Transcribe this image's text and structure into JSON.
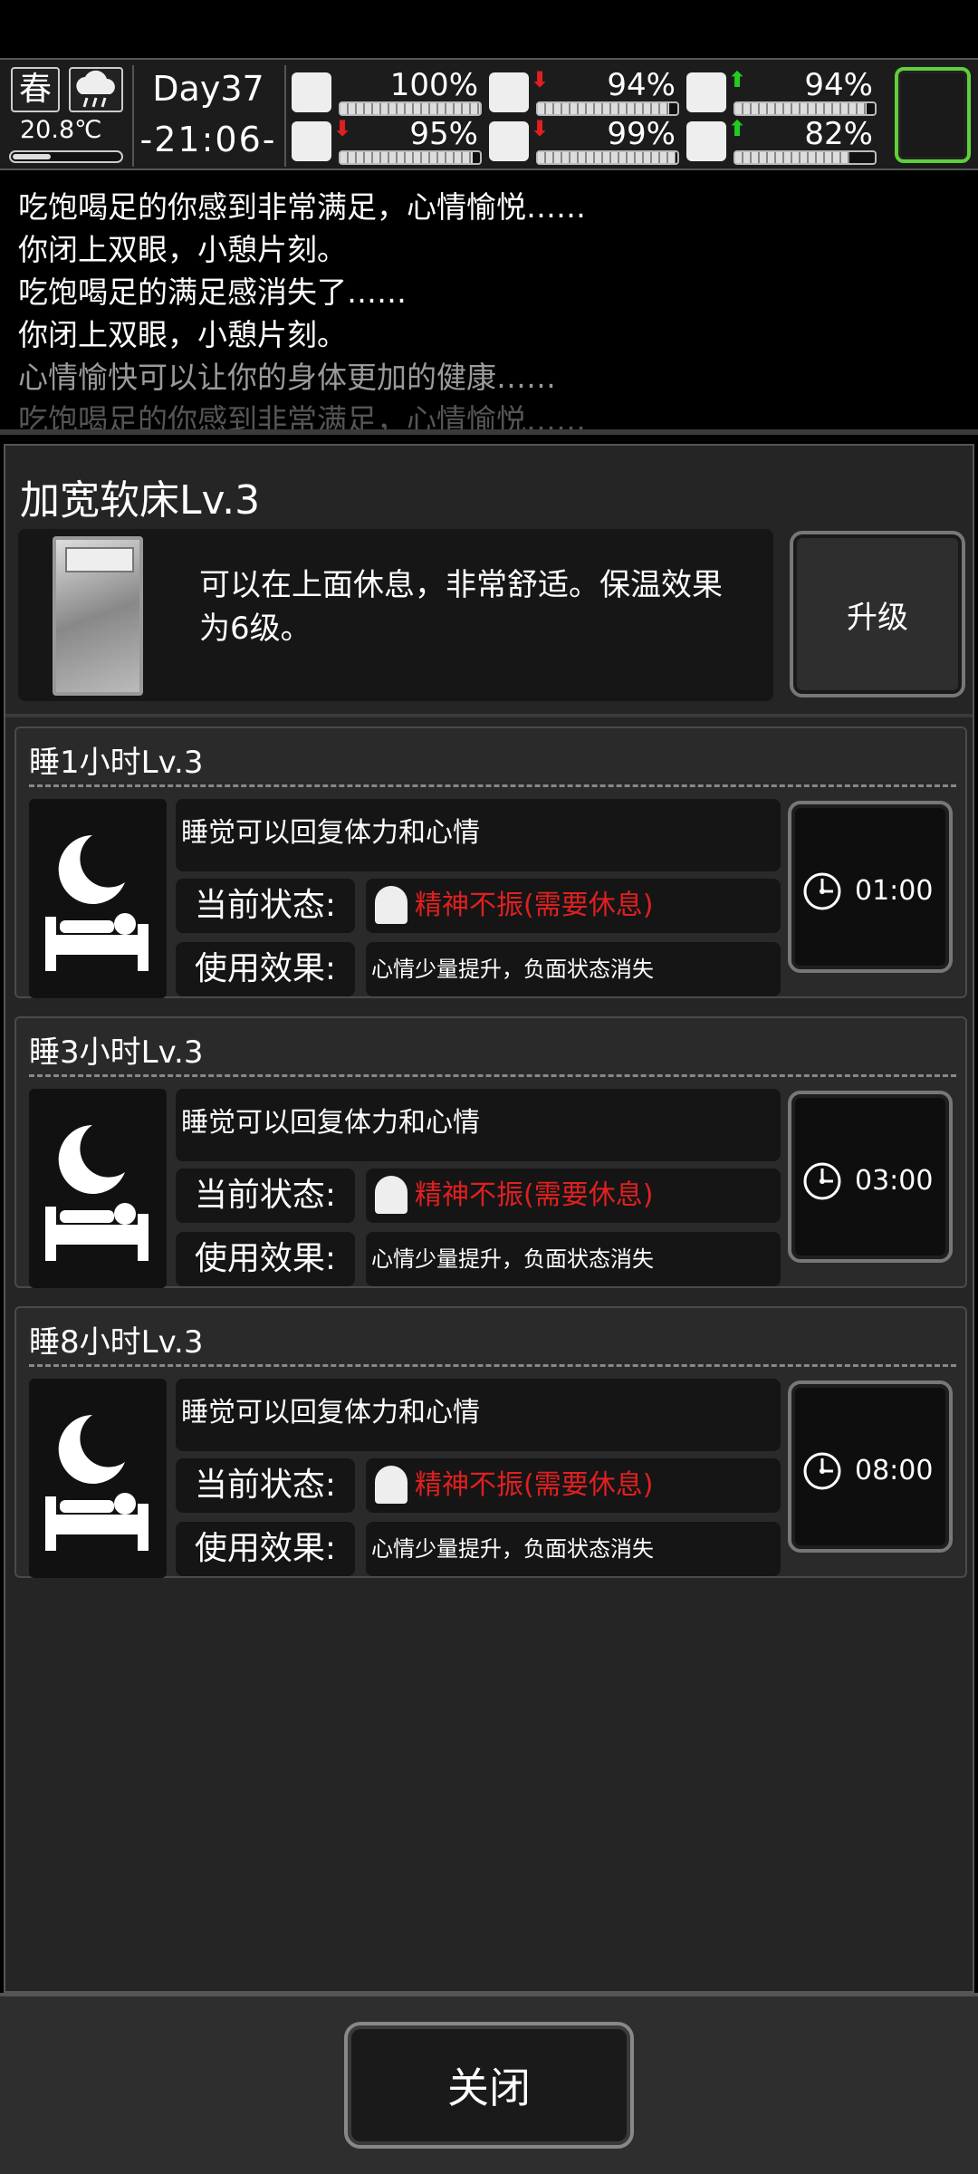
{
  "status": {
    "season": "春",
    "temperature": "20.8℃",
    "temperature_level": 0.35,
    "day": "Day37",
    "time": "-21:06-",
    "stats": [
      {
        "icon": "medkit-icon",
        "percent": "100%",
        "level": 1.0,
        "arrow": "",
        "arrow_color": ""
      },
      {
        "icon": "stomach-icon",
        "percent": "94%",
        "level": 0.94,
        "arrow": "⬇",
        "arrow_color": "#e02020"
      },
      {
        "icon": "head-icon",
        "percent": "94%",
        "level": 0.94,
        "arrow": "⬆",
        "arrow_color": "#22cc22"
      },
      {
        "icon": "boot-icon",
        "percent": "95%",
        "level": 0.95,
        "arrow": "⬇",
        "arrow_color": "#e02020"
      },
      {
        "icon": "water-drop-icon",
        "percent": "99%",
        "level": 0.99,
        "arrow": "⬇",
        "arrow_color": "#e02020"
      },
      {
        "icon": "heart-icon",
        "percent": "82%",
        "level": 0.82,
        "arrow": "⬆",
        "arrow_color": "#22cc22"
      }
    ]
  },
  "log": [
    {
      "text": "吃饱喝足的你感到非常满足，心情愉悦……",
      "color": "#ffffff"
    },
    {
      "text": "你闭上双眼，小憩片刻。",
      "color": "#ffffff"
    },
    {
      "text": "吃饱喝足的满足感消失了……",
      "color": "#ffffff"
    },
    {
      "text": "你闭上双眼，小憩片刻。",
      "color": "#ffffff"
    },
    {
      "text": "心情愉快可以让你的身体更加的健康……",
      "color": "#9a9a9a"
    },
    {
      "text": "吃饱喝足的你感到非常满足，心情愉悦……",
      "color": "#555555"
    }
  ],
  "item": {
    "title": "加宽软床Lv.3",
    "description": "可以在上面休息，非常舒适。保温效果为6级。",
    "upgrade_label": "升级"
  },
  "sleep_options": [
    {
      "title": "睡1小时Lv.3",
      "description": "睡觉可以回复体力和心情",
      "status_label": "当前状态:",
      "status_value": "精神不振(需要休息)",
      "effect_label": "使用效果:",
      "effect_value": "心情少量提升，负面状态消失",
      "time": "01:00"
    },
    {
      "title": "睡3小时Lv.3",
      "description": "睡觉可以回复体力和心情",
      "status_label": "当前状态:",
      "status_value": "精神不振(需要休息)",
      "effect_label": "使用效果:",
      "effect_value": "心情少量提升，负面状态消失",
      "time": "03:00"
    },
    {
      "title": "睡8小时Lv.3",
      "description": "睡觉可以回复体力和心情",
      "status_label": "当前状态:",
      "status_value": "精神不振(需要休息)",
      "effect_label": "使用效果:",
      "effect_value": "心情少量提升，负面状态消失",
      "time": "08:00"
    }
  ],
  "close_label": "关闭"
}
